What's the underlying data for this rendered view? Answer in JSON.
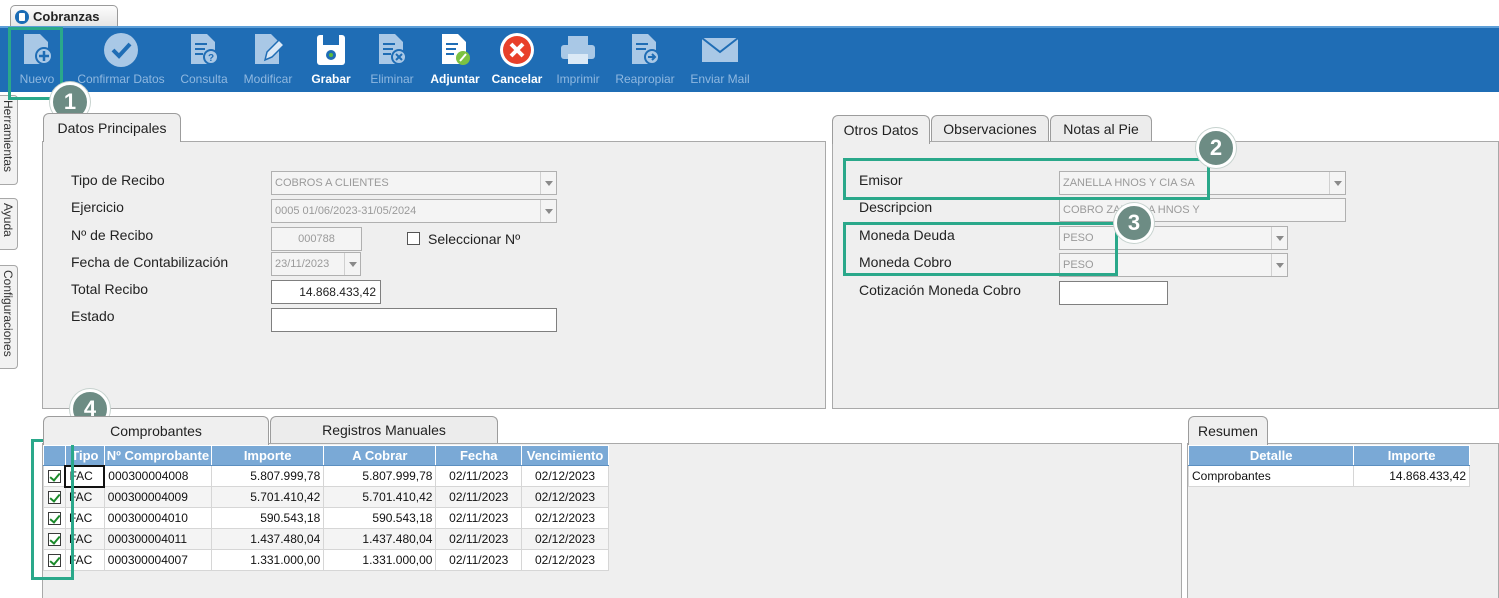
{
  "window": {
    "tab_title": "Cobranzas"
  },
  "toolbar": {
    "buttons": [
      {
        "label": "Nuevo",
        "icon": "new-document-icon",
        "enabled": false
      },
      {
        "label": "Confirmar Datos",
        "icon": "checkmark-icon",
        "enabled": false
      },
      {
        "label": "Consulta",
        "icon": "query-document-icon",
        "enabled": false
      },
      {
        "label": "Modificar",
        "icon": "edit-pencil-icon",
        "enabled": false
      },
      {
        "label": "Grabar",
        "icon": "save-disk-icon",
        "enabled": true
      },
      {
        "label": "Eliminar",
        "icon": "delete-document-icon",
        "enabled": false
      },
      {
        "label": "Adjuntar",
        "icon": "attach-icon",
        "enabled": true
      },
      {
        "label": "Cancelar",
        "icon": "cancel-icon",
        "enabled": true
      },
      {
        "label": "Imprimir",
        "icon": "printer-icon",
        "enabled": false
      },
      {
        "label": "Reapropiar",
        "icon": "reassign-icon",
        "enabled": false
      },
      {
        "label": "Enviar Mail",
        "icon": "mail-icon",
        "enabled": false
      }
    ]
  },
  "side_tabs": [
    "Herramientas",
    "Ayuda",
    "Configuraciones"
  ],
  "datos_principales": {
    "tab": "Datos Principales",
    "tipo_recibo": {
      "label": "Tipo de Recibo",
      "value": "COBROS A CLIENTES"
    },
    "ejercicio": {
      "label": "Ejercicio",
      "value": "0005 01/06/2023-31/05/2024"
    },
    "nro_recibo": {
      "label": "Nº de Recibo",
      "value": "000788"
    },
    "seleccionar": {
      "label": "Seleccionar Nº",
      "checked": false
    },
    "fecha_contab": {
      "label": "Fecha de Contabilización",
      "value": "23/11/2023"
    },
    "total_recibo": {
      "label": "Total Recibo",
      "value": "14.868.433,42"
    },
    "estado": {
      "label": "Estado",
      "value": ""
    }
  },
  "otros_datos": {
    "tabs": [
      "Otros Datos",
      "Observaciones",
      "Notas al Pie"
    ],
    "emisor": {
      "label": "Emisor",
      "value": "ZANELLA HNOS Y CIA SA"
    },
    "descripcion": {
      "label": "Descripcion",
      "value": "COBRO ZANELLA HNOS Y"
    },
    "moneda_deuda": {
      "label": "Moneda Deuda",
      "value": "PESO"
    },
    "moneda_cobro": {
      "label": "Moneda Cobro",
      "value": "PESO"
    },
    "cotizacion": {
      "label": "Cotización Moneda Cobro",
      "value": ""
    }
  },
  "comprobantes": {
    "tabs": [
      "Comprobantes",
      "Registros Manuales"
    ],
    "columns": [
      "",
      "Tipo",
      "Nº Comprobante",
      "Importe",
      "A Cobrar",
      "Fecha",
      "Vencimiento"
    ],
    "rows": [
      {
        "checked": true,
        "tipo": "FAC",
        "numero": "000300004008",
        "importe": "5.807.999,78",
        "a_cobrar": "5.807.999,78",
        "fecha": "02/11/2023",
        "vencimiento": "02/12/2023"
      },
      {
        "checked": true,
        "tipo": "FAC",
        "numero": "000300004009",
        "importe": "5.701.410,42",
        "a_cobrar": "5.701.410,42",
        "fecha": "02/11/2023",
        "vencimiento": "02/12/2023"
      },
      {
        "checked": true,
        "tipo": "FAC",
        "numero": "000300004010",
        "importe": "590.543,18",
        "a_cobrar": "590.543,18",
        "fecha": "02/11/2023",
        "vencimiento": "02/12/2023"
      },
      {
        "checked": true,
        "tipo": "FAC",
        "numero": "000300004011",
        "importe": "1.437.480,04",
        "a_cobrar": "1.437.480,04",
        "fecha": "02/11/2023",
        "vencimiento": "02/12/2023"
      },
      {
        "checked": true,
        "tipo": "FAC",
        "numero": "000300004007",
        "importe": "1.331.000,00",
        "a_cobrar": "1.331.000,00",
        "fecha": "02/11/2023",
        "vencimiento": "02/12/2023"
      }
    ]
  },
  "resumen": {
    "tab": "Resumen",
    "columns": [
      "Detalle",
      "Importe"
    ],
    "rows": [
      {
        "detalle": "Comprobantes",
        "importe": "14.868.433,42"
      }
    ]
  },
  "annotations": {
    "badges": [
      "1",
      "2",
      "3",
      "4"
    ],
    "color": "#2aa88a"
  }
}
